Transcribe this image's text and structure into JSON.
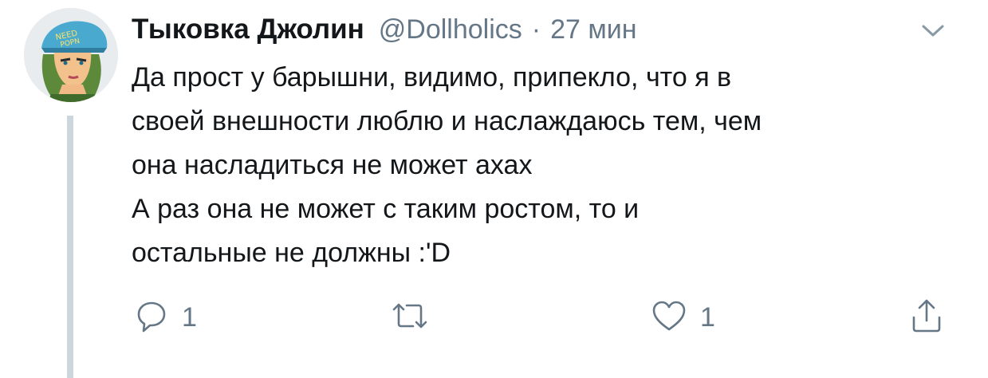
{
  "tweet": {
    "display_name": "Тыковка Джолин",
    "handle": "@Dollholics",
    "separator": "·",
    "time": "27 мин",
    "avatar_icon": "avatar-jolyne-icon",
    "avatar_cap_text": "NEED POPN",
    "text_lines": [
      "Да прост у барышни, видимо, припекло, что я в",
      "своей внешности люблю и наслаждаюсь тем, чем",
      "она насладиться не может ахах",
      "А раз она не может с таким ростом, то и",
      "остальные не должны :'D"
    ],
    "actions": {
      "reply": {
        "icon": "reply-icon",
        "count": "1"
      },
      "retweet": {
        "icon": "retweet-icon",
        "count": ""
      },
      "like": {
        "icon": "heart-icon",
        "count": "1"
      },
      "share": {
        "icon": "share-icon"
      }
    }
  },
  "colors": {
    "text": "#14171a",
    "muted": "#657786",
    "thread_line": "#ccd6dd"
  }
}
